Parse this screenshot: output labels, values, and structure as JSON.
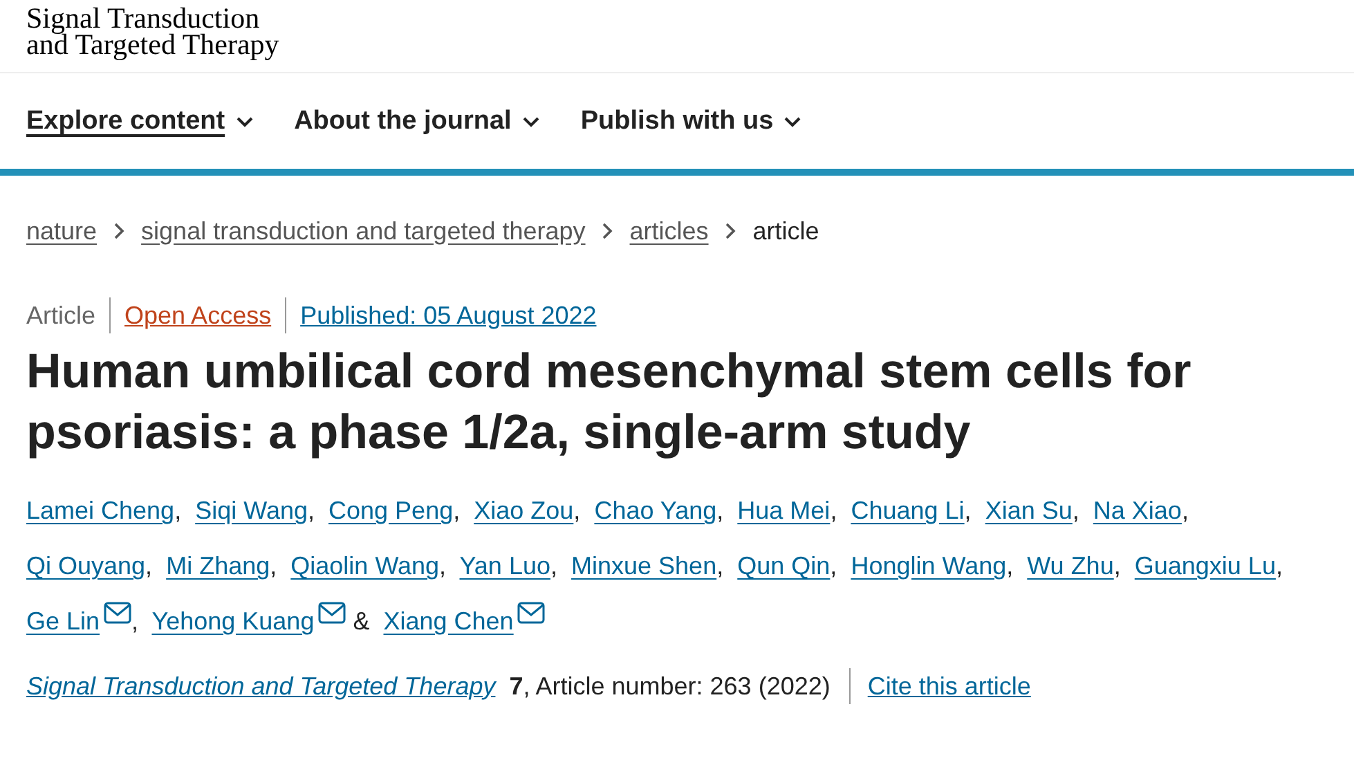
{
  "logo": {
    "line_1": "Signal Transduction",
    "line_2": "and Targeted Therapy"
  },
  "nav": [
    {
      "label": "Explore content",
      "selected": true
    },
    {
      "label": "About the journal",
      "selected": false
    },
    {
      "label": "Publish with us",
      "selected": false
    }
  ],
  "breadcrumbs": [
    {
      "label": "nature",
      "current": false
    },
    {
      "label": "signal transduction and targeted therapy",
      "current": false
    },
    {
      "label": "articles",
      "current": false
    },
    {
      "label": "article",
      "current": true
    }
  ],
  "article_info": {
    "type": "Article",
    "access": "Open Access",
    "published": "Published: 05 August 2022"
  },
  "title": "Human umbilical cord mesenchymal stem cells for psoriasis: a phase 1/2a, single-arm study",
  "authors": [
    {
      "name": "Lamei Cheng",
      "after": ","
    },
    {
      "name": "Siqi Wang",
      "after": ","
    },
    {
      "name": "Cong Peng",
      "after": ","
    },
    {
      "name": "Xiao Zou",
      "after": ","
    },
    {
      "name": "Chao Yang",
      "after": ","
    },
    {
      "name": "Hua Mei",
      "after": ","
    },
    {
      "name": "Chuang Li",
      "after": ","
    },
    {
      "name": "Xian Su",
      "after": ","
    },
    {
      "name": "Na Xiao",
      "after": ","
    },
    {
      "name": "Qi Ouyang",
      "after": ","
    },
    {
      "name": "Mi Zhang",
      "after": ","
    },
    {
      "name": "Qiaolin Wang",
      "after": ","
    },
    {
      "name": "Yan Luo",
      "after": ","
    },
    {
      "name": "Minxue Shen",
      "after": ","
    },
    {
      "name": "Qun Qin",
      "after": ","
    },
    {
      "name": "Honglin Wang",
      "after": ","
    },
    {
      "name": "Wu Zhu",
      "after": ","
    },
    {
      "name": "Guangxiu Lu",
      "after": ","
    },
    {
      "name": "Ge Lin",
      "email": true,
      "after": ","
    },
    {
      "name": "Yehong Kuang",
      "email": true,
      "after": "&"
    },
    {
      "name": "Xiang Chen",
      "email": true
    }
  ],
  "citation": {
    "journal": "Signal Transduction and Targeted Therapy",
    "volume": "7",
    "details": ", Article number: 263 (2022)",
    "cite_link": "Cite this article"
  }
}
